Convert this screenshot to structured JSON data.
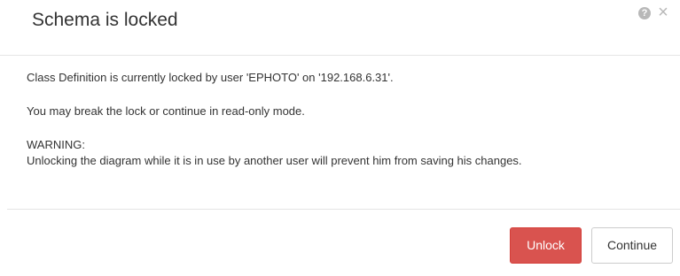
{
  "dialog": {
    "title": "Schema is locked",
    "help_icon": "?",
    "close_icon": "×",
    "message_lock": "Class Definition is currently locked by user 'EPHOTO' on '192.168.6.31'.",
    "message_options": "You may break the lock or continue in read-only mode.",
    "warning_heading": "WARNING:",
    "warning_text": "Unlocking the diagram while it is in use by another user will prevent him from saving his changes.",
    "buttons": {
      "unlock_label": "Unlock",
      "continue_label": "Continue"
    }
  },
  "colors": {
    "danger": "#d9534f",
    "icon_gray": "#b8b8b8",
    "divider": "#e5e5e5"
  }
}
